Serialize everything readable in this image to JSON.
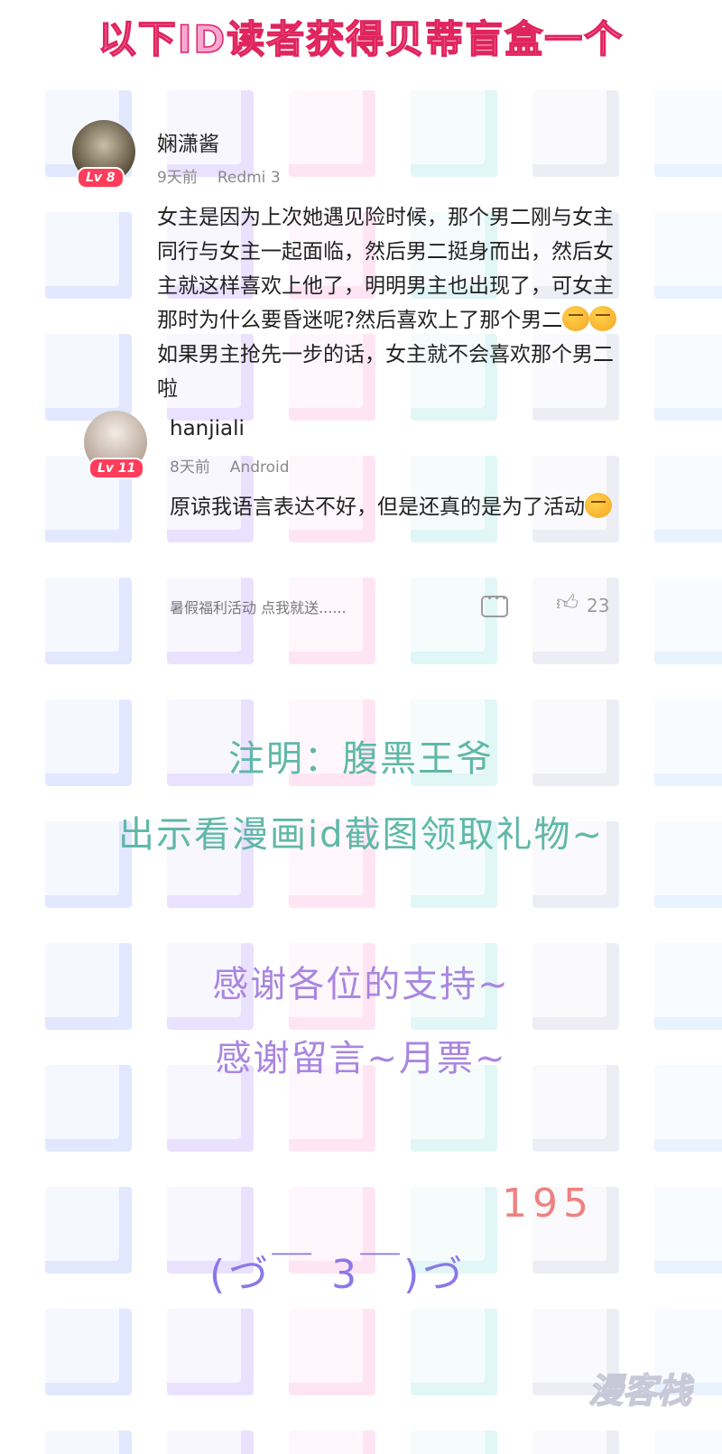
{
  "banner": {
    "title": "以下ID读者获得贝蒂盲盒一个"
  },
  "comment": {
    "user": "娴潇酱",
    "level": "Lv 8",
    "time": "9天前",
    "device": "Redmi 3",
    "text_part1": "女主是因为上次她遇见险时候，那个男二刚与女主同行与女主一起面临，然后男二挺身而出，然后女主就这样喜欢上他了，明明男主也出现了，可女主那时为什么要昏迷呢?然后喜欢上了那个男二",
    "text_part2": "如果男主抢先一步的话，女主就不会喜欢那个男二啦"
  },
  "reply": {
    "user": "hanjiali",
    "level": "Lv 11",
    "time": "8天前",
    "device": "Android",
    "text": "原谅我语言表达不好，但是还真的是为了活动"
  },
  "footer": {
    "link": "暑假福利活动 点我就送......",
    "likes": "23"
  },
  "notes": {
    "line1": "注明：腹黑王爷",
    "line2": "出示看漫画id截图领取礼物~",
    "line3": "感谢各位的支持~",
    "line4": "感谢留言~月票~"
  },
  "signature": {
    "number": "195",
    "kaomoji": "(づ￣ 3￣)づ"
  },
  "watermark": "漫客栈",
  "colors": {
    "banner_fill": "#f9a8d4",
    "banner_stroke": "#e0245e",
    "level_badge": "#ff3d5a",
    "note_teal": "#5fb8a8",
    "note_purple": "#a986e0"
  },
  "icons": [
    "comment-icon",
    "thumbs-up-icon",
    "sweat-emoji-icon"
  ]
}
